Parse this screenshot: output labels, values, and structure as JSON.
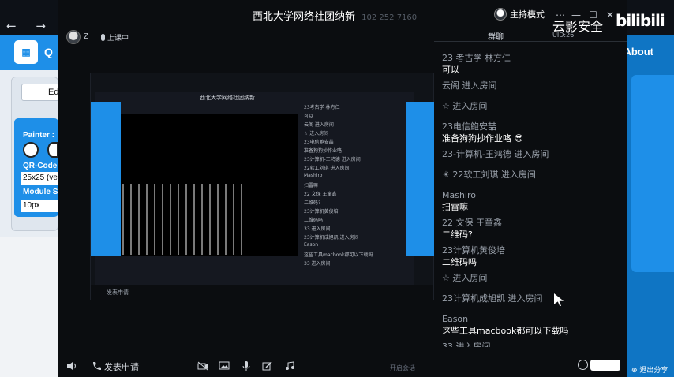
{
  "background_app": {
    "nav_arrows": "← →",
    "title": "Q",
    "about_label": "About",
    "edit_label": "Ed",
    "painter_label": "Painter",
    "qr_code_label": "QR-Code",
    "size_value": "25x25 (ve",
    "module_label": "Module S",
    "px_value": "10px"
  },
  "meeting": {
    "room_title": "西北大学网络社团纳新",
    "room_id": "102 252 7160",
    "user_name": "Z",
    "mic_status": "上课中",
    "host_mode": "主持模式",
    "win_controls": [
      "⋯",
      "—",
      "☐",
      "✕"
    ]
  },
  "shared_screen": {
    "title": "西北大学网络社团纳新",
    "inner_chat_lines": [
      "23考古学 林方仁",
      "可以",
      "云阁 进入房间",
      "☆ 进入房间",
      "23电信鲍安喆",
      "准备狗狗抄作业咯",
      "23计算机-王鸿德 进入房间",
      "22软工刘琪 进入房间",
      "Mashiro",
      "扫雷嘛",
      "22 文保 王童鑫",
      "二维码?",
      "23计算机黄俊培",
      "二维码吗",
      "33 进入房间",
      "23计算机成旭凯 进入房间",
      "Eason",
      "这些工具macbook都可以下载吗",
      "33 进入房间"
    ],
    "bottom_text": "发表申请"
  },
  "chat": {
    "tab_label": "群聊",
    "messages": [
      {
        "sender": "23 考古学 林方仁",
        "text": "可以"
      },
      {
        "system": "云阁 进入房间"
      },
      {
        "system": "☆ 进入房间"
      },
      {
        "sender": "23电信鲍安喆",
        "text": "准备狗狗抄作业咯 😎"
      },
      {
        "system": "23-计算机-王鸿德 进入房间"
      },
      {
        "system": "☀ 22软工刘琪 进入房间"
      },
      {
        "sender": "Mashiro",
        "text": "扫雷嘛"
      },
      {
        "sender": "22 文保 王童鑫",
        "text": "二维码?"
      },
      {
        "sender": "23计算机黄俊培",
        "text": "二维码吗"
      },
      {
        "system": "☆ 进入房间"
      },
      {
        "system": "23计算机成旭凯 进入房间"
      },
      {
        "sender": "Eason",
        "text": "这些工具macbook都可以下载吗"
      },
      {
        "system": "33 进入房间"
      }
    ]
  },
  "toolbar": {
    "apply_label": "发表申请",
    "center_label": "开启会话"
  },
  "watermark": {
    "text": "云影安全",
    "sub": "UID:26",
    "bili": "bilibili",
    "exit_share": "退出分享"
  }
}
